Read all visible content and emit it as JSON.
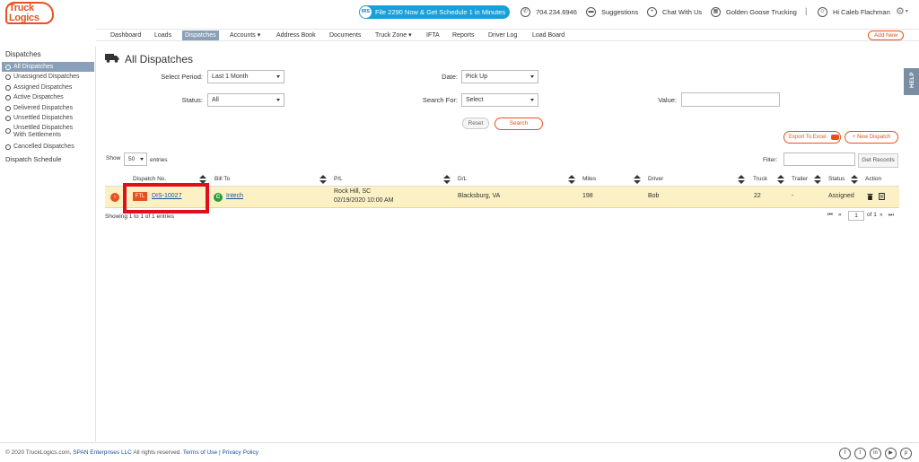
{
  "header": {
    "logo_line1": "Truck",
    "logo_line2": "Logics",
    "promo_icon": "IRS",
    "promo_text": "File 2290 Now & Get Schedule 1 in Minutes",
    "phone": "704.234.6946",
    "suggestions": "Suggestions",
    "chat": "Chat With Us",
    "company": "Golden Goose Trucking",
    "greeting": "Hi Caleb Flachman"
  },
  "nav": {
    "items": [
      "Dashboard",
      "Loads",
      "Dispatches",
      "Accounts ▾",
      "Address Book",
      "Documents",
      "Truck Zone ▾",
      "IFTA",
      "Reports",
      "Driver Log",
      "Load Board"
    ],
    "active": "Dispatches",
    "add_new": "Add New"
  },
  "sidebar": {
    "title": "Dispatches",
    "items": [
      "All Dispatches",
      "Unassigned Dispatches",
      "Assigned Dispatches",
      "Active Dispatches",
      "Delivered Dispatches",
      "Unsettled Dispatches",
      "Unsettled Dispatches",
      "With Settlements",
      "Cancelled Dispatches"
    ],
    "schedule": "Dispatch Schedule"
  },
  "page": {
    "title": "All Dispatches",
    "help": "HELP"
  },
  "filters": {
    "period_label": "Select Period:",
    "period_value": "Last 1 Month",
    "date_label": "Date:",
    "date_value": "Pick Up",
    "status_label": "Status:",
    "status_value": "All",
    "search_for_label": "Search For:",
    "search_for_value": "Select",
    "value_label": "Value:",
    "reset": "Reset",
    "search": "Search"
  },
  "toolbar": {
    "export": "Export To Excel",
    "new_dispatch": "+ New Dispatch",
    "show": "Show",
    "show_value": "50",
    "entries": "entries",
    "filter_label": "Filter:",
    "get_records": "Get Records"
  },
  "table": {
    "headers": [
      "Dispatch No.",
      "Bill To",
      "P/L",
      "D/L",
      "Miles",
      "Driver",
      "Truck",
      "Trailer",
      "Status",
      "Action"
    ],
    "rows": [
      {
        "ftl": "FTL",
        "dispatch_no": "DIS-10027",
        "bill_badge": "C",
        "bill_to": "Intech",
        "pl_city": "Rock Hill, SC",
        "pl_time": "02/19/2020 10:00 AM",
        "dl": "Blacksburg, VA",
        "miles": "198",
        "driver": "Bob",
        "truck": "22",
        "trailer": "-",
        "status": "Assigned"
      }
    ],
    "showing": "Showing 1 to 1 of 1 entries",
    "page": "1",
    "of_pages": "of 1"
  },
  "footer": {
    "copy1": "© 2020 TruckLogics.com,",
    "copy2": "SPAN Enterprises LLC",
    "copy3": "All rights reserved.",
    "terms": "Terms of Use",
    "pipe": "|",
    "privacy": "Privacy Policy",
    "social": [
      "f",
      "t",
      "in",
      "▶",
      "p"
    ]
  },
  "colors": {
    "brand": "#e8511f",
    "promo": "#1aa0d9",
    "nav_active": "#8aa0b8",
    "row_highlight": "#fbf1c4",
    "annotation_box": "#e0101a"
  }
}
